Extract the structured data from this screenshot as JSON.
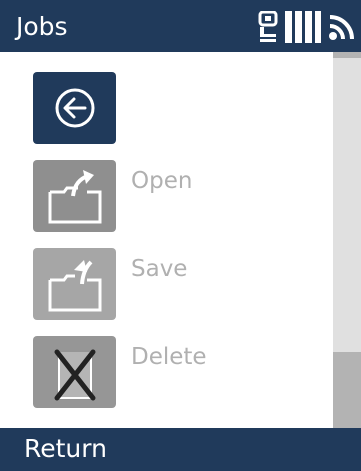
{
  "header": {
    "title": "Jobs",
    "icons": [
      "device-icon",
      "battery-icon",
      "signal-icon"
    ]
  },
  "menu": {
    "items": [
      {
        "id": "back",
        "label": "",
        "icon": "back-arrow-icon",
        "enabled": true
      },
      {
        "id": "open",
        "label": "Open",
        "icon": "open-folder-icon",
        "enabled": false
      },
      {
        "id": "save",
        "label": "Save",
        "icon": "save-folder-icon",
        "enabled": false
      },
      {
        "id": "delete",
        "label": "Delete",
        "icon": "delete-icon",
        "enabled": false
      }
    ]
  },
  "footer": {
    "softkey_label": "Return"
  },
  "colors": {
    "bar": "#203a5b",
    "disabled_tile": "#8f8f8f",
    "disabled_text": "#b0b0b0",
    "scroll_track": "#b3b3b3"
  }
}
